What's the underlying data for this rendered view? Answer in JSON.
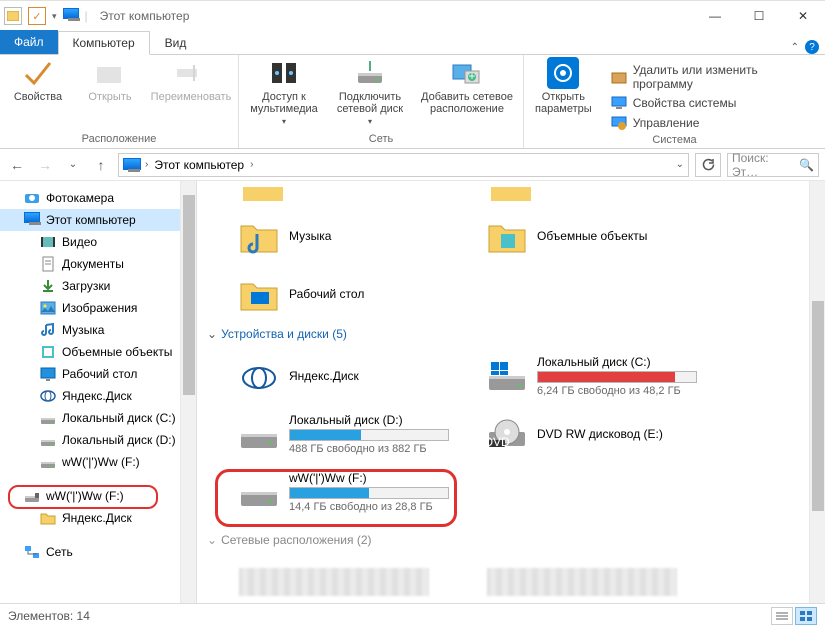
{
  "window": {
    "title": "Этот компьютер",
    "controls": {
      "min": "—",
      "max": "☐",
      "close": "✕"
    }
  },
  "tabs": {
    "file": "Файл",
    "computer": "Компьютер",
    "view": "Вид"
  },
  "ribbon": {
    "groups": {
      "location": {
        "label": "Расположение",
        "properties": "Свойства",
        "open": "Открыть",
        "rename": "Переименовать"
      },
      "network": {
        "label": "Сеть",
        "media": "Доступ к\nмультимедиа",
        "mapdrive": "Подключить\nсетевой диск",
        "addnet": "Добавить сетевое\nрасположение"
      },
      "system": {
        "label": "Система",
        "openparams": "Открыть\nпараметры",
        "uninstall": "Удалить или изменить программу",
        "sysprops": "Свойства системы",
        "manage": "Управление"
      }
    }
  },
  "addressbar": {
    "path_root": "Этот компьютер",
    "search_placeholder": "Поиск: Эт…"
  },
  "nav": {
    "items": [
      {
        "label": "Фотокамера",
        "icon": "camera-icon"
      },
      {
        "label": "Этот компьютер",
        "icon": "pc-icon",
        "selected": true
      },
      {
        "label": "Видео",
        "icon": "video-icon",
        "lvl": 2
      },
      {
        "label": "Документы",
        "icon": "documents-icon",
        "lvl": 2
      },
      {
        "label": "Загрузки",
        "icon": "downloads-icon",
        "lvl": 2
      },
      {
        "label": "Изображения",
        "icon": "pictures-icon",
        "lvl": 2
      },
      {
        "label": "Музыка",
        "icon": "music-icon",
        "lvl": 2
      },
      {
        "label": "Объемные объекты",
        "icon": "3d-icon",
        "lvl": 2
      },
      {
        "label": "Рабочий стол",
        "icon": "desktop-icon",
        "lvl": 2
      },
      {
        "label": "Яндекс.Диск",
        "icon": "yadisk-icon",
        "lvl": 2
      },
      {
        "label": "Локальный диск (C:)",
        "icon": "drive-icon",
        "lvl": 2
      },
      {
        "label": "Локальный диск (D:)",
        "icon": "drive-icon",
        "lvl": 2
      },
      {
        "label": "wW('|')Ww (F:)",
        "icon": "drive-icon",
        "lvl": 2,
        "circled": true
      },
      {
        "label": "wW('|')Ww (F:)",
        "icon": "usb-icon"
      },
      {
        "label": "Яндекс.Диск",
        "icon": "folder-icon",
        "lvl": 2
      },
      {
        "label": "Сеть",
        "icon": "network-icon"
      }
    ]
  },
  "content": {
    "folders": [
      {
        "label": "Музыка"
      },
      {
        "label": "Объемные объекты"
      },
      {
        "label": "Рабочий стол"
      }
    ],
    "drives_header": "Устройства и диски (5)",
    "drives": [
      {
        "name": "Яндекс.Диск",
        "type": "cloud"
      },
      {
        "name": "Локальный диск (C:)",
        "free": "6,24 ГБ свободно из 48,2 ГБ",
        "pct": 87,
        "warn": true
      },
      {
        "name": "Локальный диск (D:)",
        "free": "488 ГБ свободно из 882 ГБ",
        "pct": 45
      },
      {
        "name": "DVD RW дисковод (E:)",
        "type": "dvd"
      },
      {
        "name": "wW('|')Ww (F:)",
        "free": "14,4 ГБ свободно из 28,8 ГБ",
        "pct": 50,
        "circled": true
      }
    ],
    "netloc_header": "Сетевые расположения (2)"
  },
  "statusbar": {
    "count_label": "Элементов: 14"
  }
}
